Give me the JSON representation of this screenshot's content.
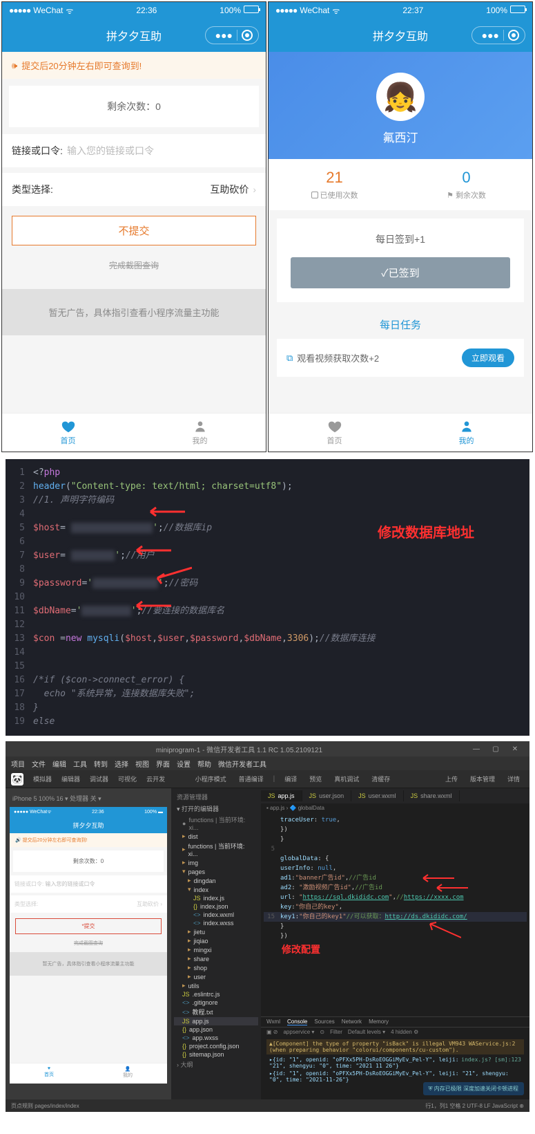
{
  "phone1": {
    "status": {
      "carrier": "WeChat",
      "time": "22:36",
      "battery": "100%"
    },
    "nav": {
      "title": "拼夕夕互助"
    },
    "notice": "提交后20分钟左右即可查询到!",
    "remaining": "剩余次数：0",
    "form": {
      "link_label": "链接或口令:",
      "link_placeholder": "输入您的链接或口令",
      "type_label": "类型选择:",
      "type_value": "互助砍价"
    },
    "submit": "不提交",
    "completed": "完成截图查询",
    "ad": "暂无广告，具体指引查看小程序流量主功能",
    "tabs": {
      "home": "首页",
      "mine": "我的"
    }
  },
  "phone2": {
    "status": {
      "carrier": "WeChat",
      "time": "22:37",
      "battery": "100%"
    },
    "nav": {
      "title": "拼夕夕互助"
    },
    "nickname": "氟西汀",
    "stats": {
      "used_num": "21",
      "used_label": "已使用次数",
      "remain_num": "0",
      "remain_label": "剩余次数"
    },
    "signin": {
      "title": "每日签到+1",
      "btn": "✓已签到"
    },
    "daily_task": "每日任务",
    "task": {
      "text": "观看视频获取次数+2",
      "btn": "立即观看"
    },
    "tabs": {
      "home": "首页",
      "mine": "我的"
    }
  },
  "code": {
    "annotation": "修改数据库地址",
    "lines": [
      {
        "n": "1",
        "html": "<span class='c-op'>&lt;?</span><span class='c-keyword'>php</span>"
      },
      {
        "n": "2",
        "html": "<span class='c-func'>header</span><span class='c-op'>(</span><span class='c-string'>\"Content-type: text/html; charset=utf8\"</span><span class='c-op'>);</span>"
      },
      {
        "n": "3",
        "html": "<span class='c-comment'>//1. 声明字符编码</span>"
      },
      {
        "n": "4",
        "html": ""
      },
      {
        "n": "5",
        "html": "<span class='c-var'>$host</span><span class='c-op'>=</span> <span class='c-blur'>xxxxxxxxxx</span><span class='c-string'>'</span><span class='c-op'>;</span><span class='c-comment'>//数据库ip</span>"
      },
      {
        "n": "6",
        "html": ""
      },
      {
        "n": "7",
        "html": "<span class='c-var'>$user</span><span class='c-op'>=</span> <span class='c-blur'>xxx</span><span class='c-string'>'</span><span class='c-op'>;</span><span class='c-comment'>//用户</span>"
      },
      {
        "n": "8",
        "html": ""
      },
      {
        "n": "9",
        "html": "<span class='c-var'>$password</span><span class='c-op'>=</span><span class='c-string'>'</span><span class='c-blur'>xxxxxxx</span><span class='c-string'>'</span><span class='c-op'>;</span><span class='c-comment'>//密码</span>"
      },
      {
        "n": "10",
        "html": ""
      },
      {
        "n": "11",
        "html": "<span class='c-var'>$dbName</span><span class='c-op'>=</span><span class='c-string'>'</span><span class='c-blur'>xxxx</span><span class='c-string'>'</span><span class='c-op'>;</span><span class='c-comment'>//要连接的数据库名</span>"
      },
      {
        "n": "12",
        "html": ""
      },
      {
        "n": "13",
        "html": "<span class='c-var'>$con</span> <span class='c-op'>=</span><span class='c-new'>new</span> <span class='c-func'>mysqli</span><span class='c-op'>(</span><span class='c-var'>$host</span><span class='c-op'>,</span><span class='c-var'>$user</span><span class='c-op'>,</span><span class='c-var'>$password</span><span class='c-op'>,</span><span class='c-var'>$dbName</span><span class='c-op'>,</span><span class='c-num'>3306</span><span class='c-op'>);</span><span class='c-comment'>//数据库连接</span>"
      },
      {
        "n": "14",
        "html": ""
      },
      {
        "n": "15",
        "html": ""
      },
      {
        "n": "16",
        "html": "<span class='c-comment'>/*if ($con-&gt;connect_error) {</span>"
      },
      {
        "n": "17",
        "html": "<span class='c-comment'>  echo \"系统异常，连接数据库失败\";</span>"
      },
      {
        "n": "18",
        "html": "<span class='c-comment'>}</span>"
      },
      {
        "n": "19",
        "html": "<span class='c-comment'>else</span>"
      }
    ]
  },
  "ide": {
    "title": "miniprogram-1 - 微信开发者工具 1.1 RC 1.05.2109121",
    "menu": [
      "项目",
      "文件",
      "编辑",
      "工具",
      "转到",
      "选择",
      "视图",
      "界面",
      "设置",
      "帮助",
      "微信开发者工具"
    ],
    "toolbar": {
      "left": [
        "模拟器",
        "编辑器",
        "调试器",
        "可视化",
        "云开发"
      ],
      "mid": [
        "小程序模式",
        "普通编译"
      ],
      "right_group1": [
        "编译",
        "预览",
        "真机调试",
        "清缓存"
      ],
      "right_group2": [
        "上传",
        "版本管理",
        "详情"
      ]
    },
    "sim_bar": "iPhone 5 100% 16 ▾    处理器 关 ▾",
    "sim": {
      "time": "22:36",
      "title": "拼夕夕互助",
      "notice": "🔊 提交后20分钟左右即可查询到!",
      "remaining": "剩余次数：0",
      "link_label": "链接或口令:",
      "link_ph": "输入您的链接或口令",
      "type_label": "类型选择:",
      "type_val": "互助砍价 ›",
      "submit": "*提交",
      "done": "完成截图查询",
      "ad": "暂无广告，具体指引查看小程序流量主功能",
      "home": "首页",
      "mine": "我的"
    },
    "explorer": {
      "header1": "资源管理器",
      "header2": "打开的编辑器",
      "open_file": "functions | 当前环境: xi...",
      "items": [
        {
          "icon": "▸",
          "name": "dist",
          "type": "folder",
          "lvl": 1
        },
        {
          "icon": "▸",
          "name": "functions | 当前环境: xi...",
          "type": "folder",
          "lvl": 1
        },
        {
          "icon": "▸",
          "name": "img",
          "type": "folder",
          "lvl": 1
        },
        {
          "icon": "▾",
          "name": "pages",
          "type": "folder",
          "lvl": 1
        },
        {
          "icon": "▸",
          "name": "dingdan",
          "type": "folder",
          "lvl": 2
        },
        {
          "icon": "▾",
          "name": "index",
          "type": "folder",
          "lvl": 2
        },
        {
          "icon": "",
          "name": "index.js",
          "type": "js",
          "lvl": 3
        },
        {
          "icon": "",
          "name": "index.json",
          "type": "json",
          "lvl": 3
        },
        {
          "icon": "",
          "name": "index.wxml",
          "type": "wxml",
          "lvl": 3
        },
        {
          "icon": "",
          "name": "index.wxss",
          "type": "wxss",
          "lvl": 3
        },
        {
          "icon": "▸",
          "name": "jietu",
          "type": "folder",
          "lvl": 2
        },
        {
          "icon": "▸",
          "name": "jiqiao",
          "type": "folder",
          "lvl": 2
        },
        {
          "icon": "▸",
          "name": "mingxi",
          "type": "folder",
          "lvl": 2
        },
        {
          "icon": "▸",
          "name": "share",
          "type": "folder",
          "lvl": 2
        },
        {
          "icon": "▸",
          "name": "shop",
          "type": "folder",
          "lvl": 2
        },
        {
          "icon": "▸",
          "name": "user",
          "type": "folder",
          "lvl": 2
        },
        {
          "icon": "▸",
          "name": "utils",
          "type": "folder",
          "lvl": 1
        },
        {
          "icon": "",
          "name": ".eslintrc.js",
          "type": "js",
          "lvl": 1
        },
        {
          "icon": "",
          "name": ".gitignore",
          "type": "file",
          "lvl": 1
        },
        {
          "icon": "",
          "name": "教程.txt",
          "type": "file",
          "lvl": 1
        },
        {
          "icon": "",
          "name": "app.js",
          "type": "js",
          "lvl": 1,
          "active": true
        },
        {
          "icon": "",
          "name": "app.json",
          "type": "json",
          "lvl": 1
        },
        {
          "icon": "",
          "name": "app.wxss",
          "type": "wxss",
          "lvl": 1
        },
        {
          "icon": "",
          "name": "project.config.json",
          "type": "json",
          "lvl": 1
        },
        {
          "icon": "",
          "name": "sitemap.json",
          "type": "json",
          "lvl": 1
        }
      ],
      "footer": "› 大纲"
    },
    "tabs": [
      {
        "name": "app.js",
        "active": true
      },
      {
        "name": "user.json"
      },
      {
        "name": "user.wxml"
      },
      {
        "name": "share.wxml"
      }
    ],
    "breadcrumb": "▪ app.js › 🔷 globalData",
    "code_lines": [
      {
        "n": "",
        "c": "      <span class='ic-prop'>traceUser</span>: <span class='ic-kw'>true</span>,"
      },
      {
        "n": "",
        "c": "    })"
      },
      {
        "n": "",
        "c": "  }"
      },
      {
        "n": "5",
        "c": ""
      },
      {
        "n": "",
        "c": "  <span class='ic-prop'>globalData</span>: {"
      },
      {
        "n": "",
        "c": "    <span class='ic-prop'>userInfo</span>: <span class='ic-kw'>null</span>,"
      },
      {
        "n": "",
        "c": "    <span class='ic-prop'>ad1</span>:<span class='ic-str'>\"banner广告id\"</span>,<span class='ic-comment'>//广告id</span>"
      },
      {
        "n": "",
        "c": "    <span class='ic-prop'>ad2</span>: <span class='ic-str'>\"激励视频广告id\"</span>,<span class='ic-comment'>//广告id</span>"
      },
      {
        "n": "",
        "c": "    <span class='ic-prop'>url</span>: <span class='ic-str'>\"<span class='ic-url'>https://sql.dkididc.com</span>\"</span>,<span class='ic-comment'>//<span class='ic-url'>https://xxxx.com</span></span>"
      },
      {
        "n": "",
        "c": "    <span class='ic-prop'>key</span>:<span class='ic-str'>\"你自己的key\"</span>,"
      },
      {
        "n": "15",
        "c": "    <span class='ic-prop'>key1</span>:<span class='ic-str'>\"你自己的key1\"</span><span class='ic-comment'>//可以获取：<span class='ic-url'>http://ds.dkididc.com/</span></span>",
        "hl": true
      },
      {
        "n": "",
        "c": "  }"
      },
      {
        "n": "",
        "c": "})"
      }
    ],
    "annotation": "修改配置",
    "console": {
      "tabs": [
        "Wxml",
        "Console",
        "Sources",
        "Network",
        "Memory"
      ],
      "active_tab": "Console",
      "filter": [
        "▣ ⊘",
        "appservice ▾",
        "⊙",
        "Filter",
        "Default levels ▾",
        "4 hidden ⚙"
      ],
      "warn": "▲[Component] the type of property \"isBack\" is illegal VM943 WAService.js:2 (when preparing behavior \"colorui/components/cu-custom\").",
      "log1_right": "index.js? [sm]:123",
      "log1": "▸{id: \"1\", openid: \"oPFXx5PH-DsRoEOGGiMyEv_Pel-Y\", leiji: \"21\", shengyu: \"0\", time: \"2021 11 26\"}",
      "log2": "▸{id: \"1\", openid: \"oPFXx5PH-DsRoEOGGiMyEv_Pel-Y\", leiji: \"21\", shengyu: \"0\", time: \"2021-11-26\"}"
    },
    "statusbar": {
      "left": "页点规则  pages/index/index",
      "right": "行1，列1    空格 2    UTF-8    LF    JavaScript    ⊕"
    },
    "badge": "⛨ 内存已极限 深度加速关闭卡顿进程"
  }
}
